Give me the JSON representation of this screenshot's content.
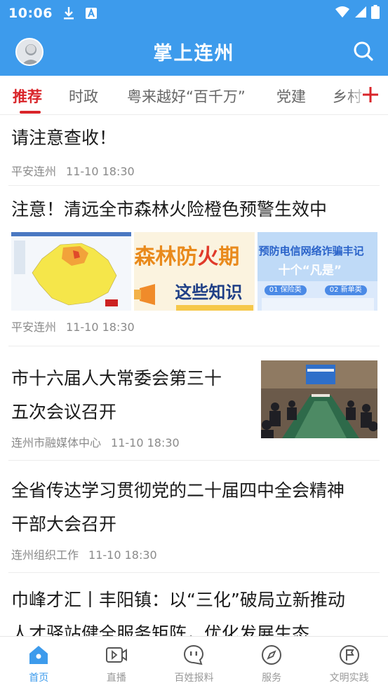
{
  "status_bar": {
    "time": "10:06"
  },
  "header": {
    "title": "掌上连州"
  },
  "tabs": [
    {
      "label": "推荐",
      "active": true
    },
    {
      "label": "时政",
      "active": false
    },
    {
      "label": "粤来越好“百千万”",
      "active": false
    },
    {
      "label": "党建",
      "active": false
    },
    {
      "label": "乡村",
      "active": false
    }
  ],
  "feed": [
    {
      "title": "请注意查收！",
      "source": "平安连州",
      "time": "11-10 18:30"
    },
    {
      "title": "注意！清远全市森林火险橙色预警生效中",
      "source": "平安连州",
      "time": "11-10 18:30",
      "thumbs": {
        "t2_line1": "森林防",
        "t2_fire": "火",
        "t2_line2": "期",
        "t2_line3": "这些知识",
        "t3_line1": "预防电信网络诈骗丰记",
        "t3_line2": "十个“凡是”",
        "t3_tag1": "01 保险类",
        "t3_tag2": "02 新单类"
      }
    },
    {
      "title_line1": "市十六届人大常委会第三十",
      "title_line2": "五次会议召开",
      "source": "连州市融媒体中心",
      "time": "11-10 18:30"
    },
    {
      "title_line1": "全省传达学习贯彻党的二十届四中全会精神",
      "title_line2": "干部大会召开",
      "source": "连州组织工作",
      "time": "11-10 18:30"
    },
    {
      "title_line1": "巾峰才汇丨丰阳镇：以“三化”破局立新推动",
      "title_line2": "人才驿站健全服务矩阵，优化发展生态"
    }
  ],
  "bottom_nav": [
    {
      "label": "首页",
      "icon": "home-icon",
      "active": true
    },
    {
      "label": "直播",
      "icon": "live-video-icon",
      "active": false
    },
    {
      "label": "百姓报料",
      "icon": "chat-icon",
      "active": false
    },
    {
      "label": "服务",
      "icon": "compass-icon",
      "active": false
    },
    {
      "label": "文明实践",
      "icon": "flag-icon",
      "active": false
    }
  ],
  "colors": {
    "brand_blue": "#3d9bec",
    "active_red": "#d9252a"
  }
}
